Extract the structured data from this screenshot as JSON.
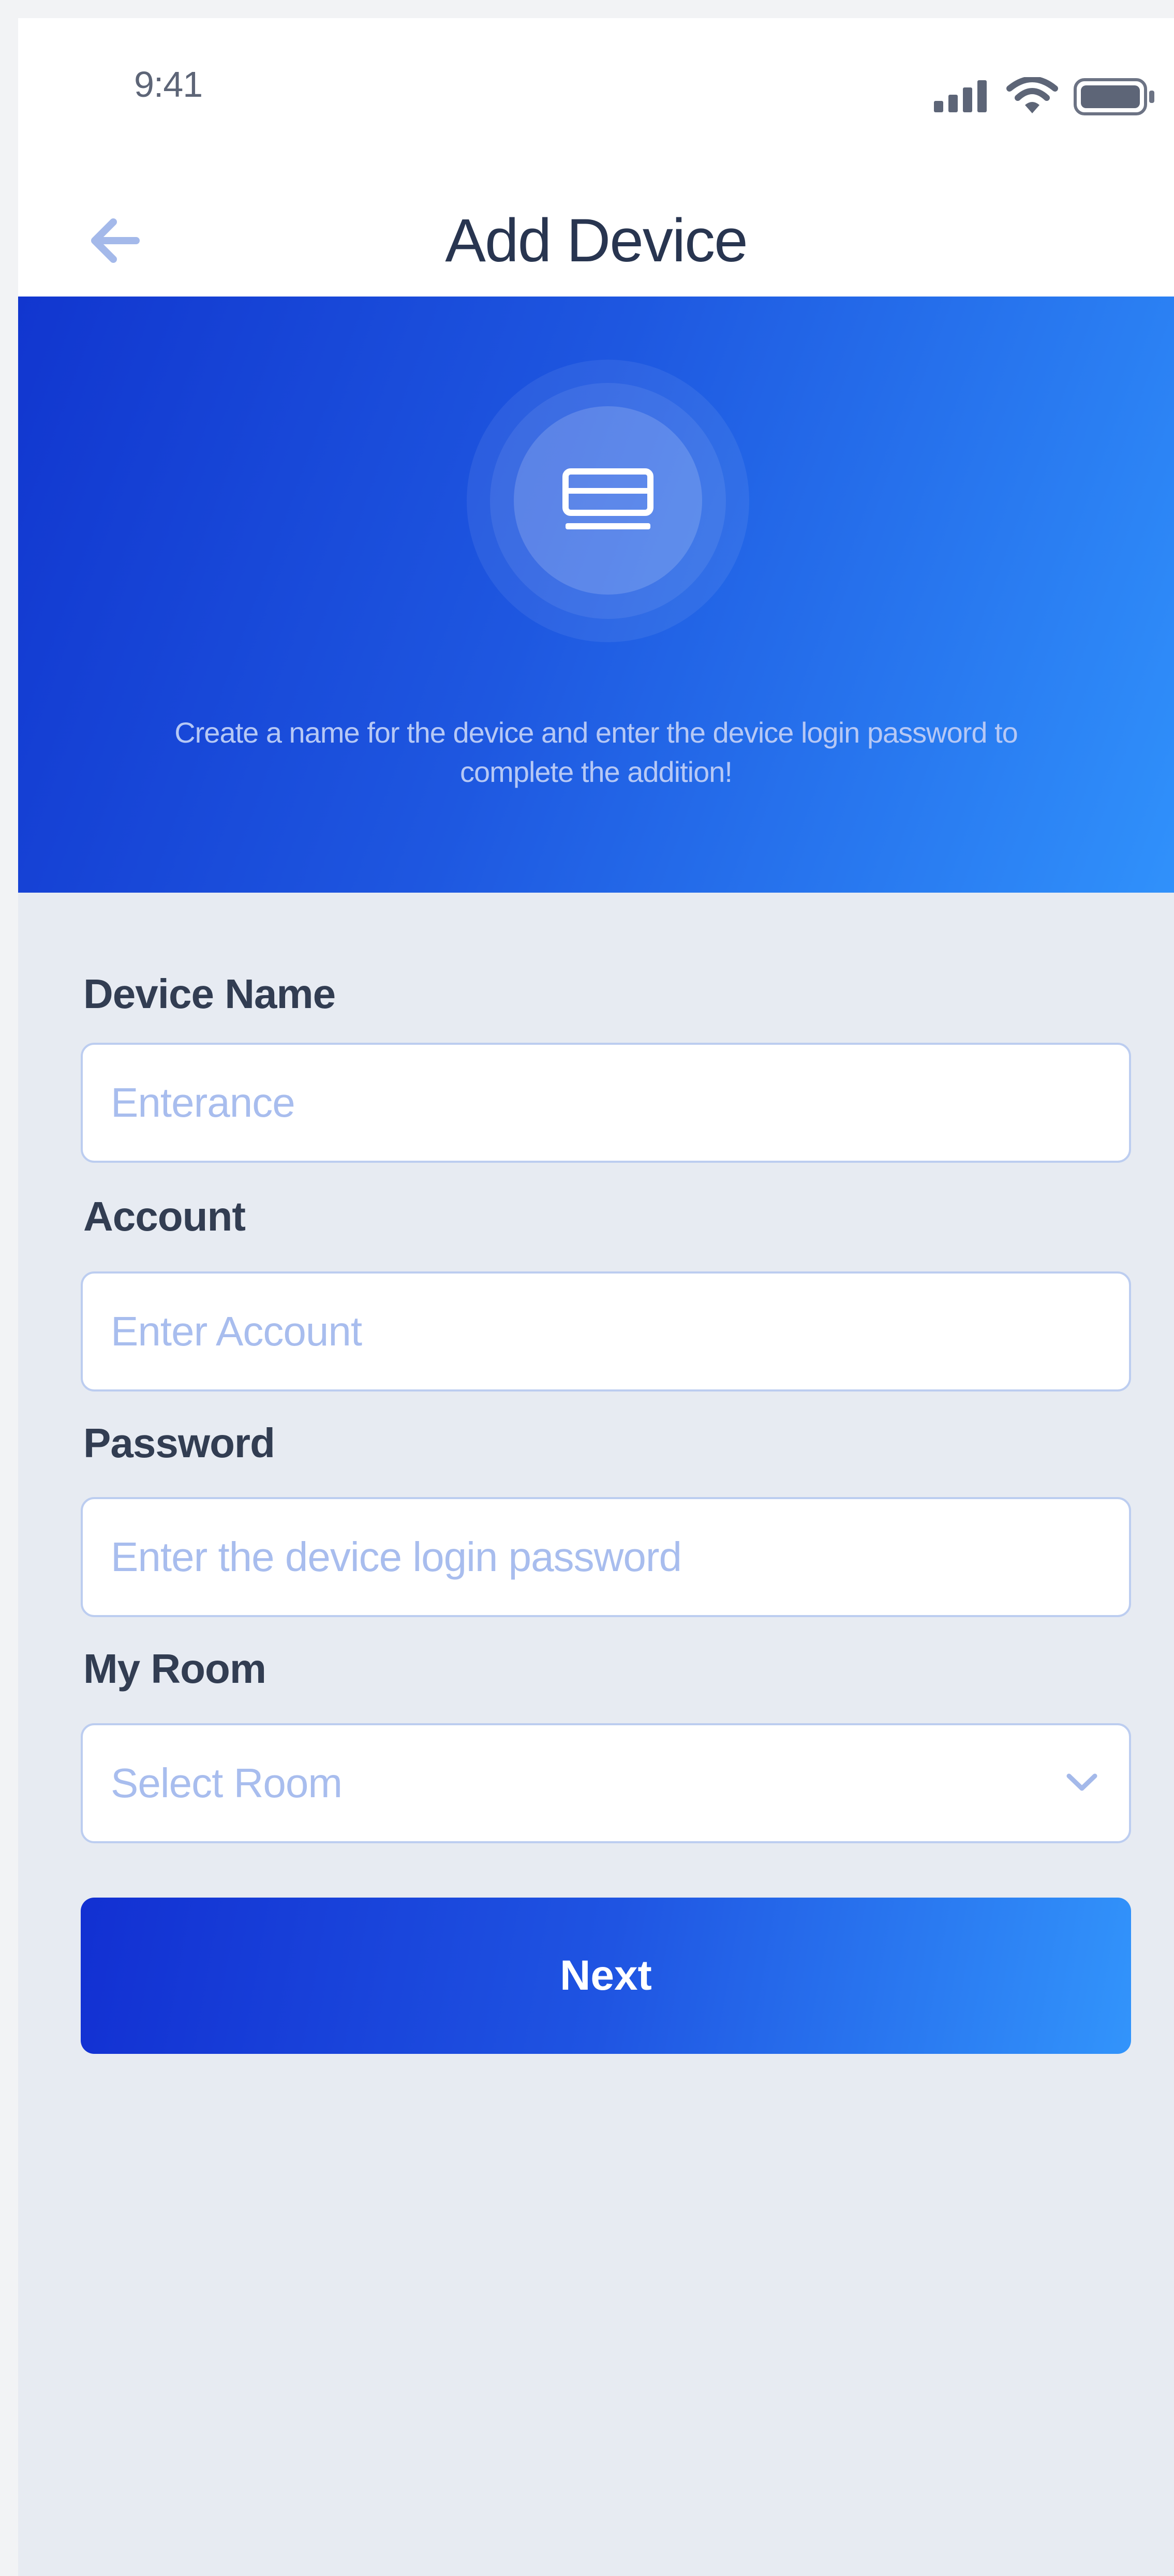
{
  "status_bar": {
    "time": "9:41",
    "icons": [
      "signal-icon",
      "wifi-icon",
      "battery-icon"
    ]
  },
  "nav": {
    "back_icon": "arrow-left-icon",
    "title": "Add Device"
  },
  "hero": {
    "icon": "device-router-icon",
    "message": "Create a name for the device and enter the device login password to complete the addition!"
  },
  "form": {
    "device_name": {
      "label": "Device Name",
      "placeholder": "Enterance"
    },
    "account": {
      "label": "Account",
      "placeholder": "Enter Account"
    },
    "password": {
      "label": "Password",
      "placeholder": "Enter the device login password"
    },
    "room": {
      "label": "My Room",
      "selected": "Select Room",
      "icon": "chevron-down-icon"
    },
    "next_label": "Next"
  },
  "colors": {
    "accent_start": "#1136cf",
    "accent_end": "#3091fb",
    "background": "#e7ebf2",
    "placeholder": "#a8bdee",
    "label": "#323d52"
  }
}
